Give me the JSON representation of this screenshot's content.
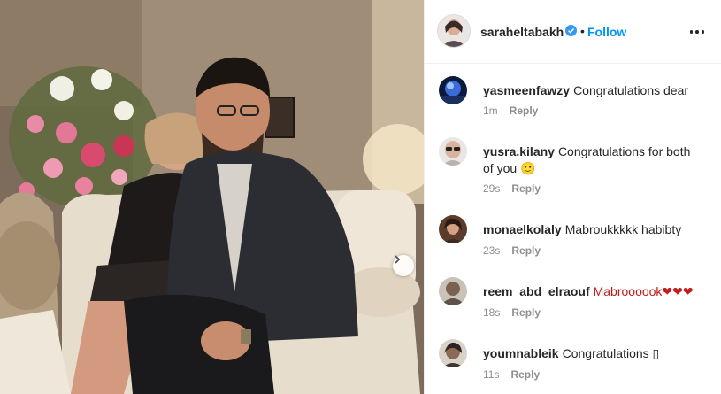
{
  "post": {
    "username": "saraheltabakh",
    "dot": "•",
    "follow_label": "Follow"
  },
  "comments": [
    {
      "username": "yasmeenfawzy",
      "text": "Congratulations dear",
      "time": "1m",
      "reply_label": "Reply"
    },
    {
      "username": "yusra.kilany",
      "text": "Congratulations for both of you 🙂",
      "time": "29s",
      "reply_label": "Reply"
    },
    {
      "username": "monaelkolaly",
      "text": "Mabroukkkkk habibty",
      "time": "23s",
      "reply_label": "Reply"
    },
    {
      "username": "reem_abd_elraouf",
      "text": "Mabroooook❤❤❤",
      "time": "18s",
      "reply_label": "Reply"
    },
    {
      "username": "youmnableik",
      "text": "Congratulations ▯",
      "time": "11s",
      "reply_label": "Reply"
    }
  ],
  "colors": {
    "link_blue": "#0095f6",
    "text": "#262626",
    "meta_gray": "#8e8e8e",
    "verified_blue": "#3897f0"
  },
  "icons": {
    "verified": "verified-badge-icon",
    "more": "more-options-icon",
    "next": "chevron-right-icon"
  }
}
